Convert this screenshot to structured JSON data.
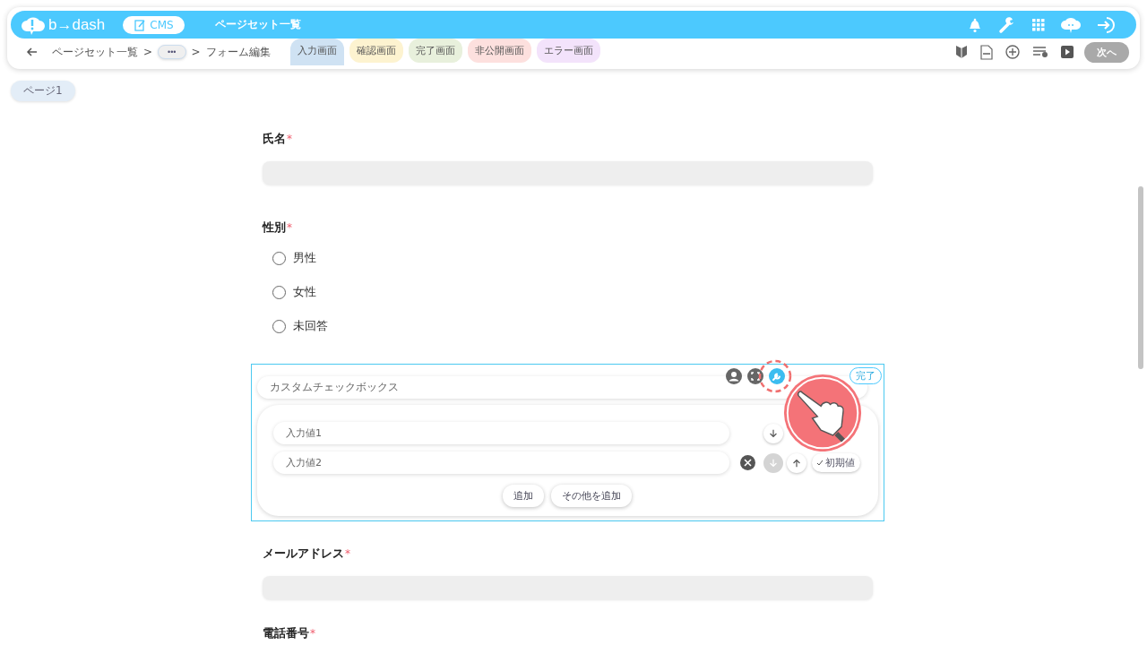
{
  "header": {
    "logo": "b→dash",
    "app_badge": "CMS",
    "title": "ページセット一覧"
  },
  "breadcrumb": {
    "items": [
      {
        "kind": "link",
        "label": "ページセット一覧"
      },
      {
        "kind": "sep",
        "label": ">"
      },
      {
        "kind": "more",
        "label": "•••"
      },
      {
        "kind": "sep",
        "label": ">"
      },
      {
        "kind": "text",
        "label": "フォーム編集"
      }
    ]
  },
  "tabs": [
    {
      "label": "入力画面",
      "selected": true,
      "color": "#cfe2f3"
    },
    {
      "label": "確認画面",
      "selected": false,
      "color": "#fdf3d0"
    },
    {
      "label": "完了画面",
      "selected": false,
      "color": "#e8f0dc"
    },
    {
      "label": "非公開画面",
      "selected": false,
      "color": "#fde0de"
    },
    {
      "label": "エラー画面",
      "selected": false,
      "color": "#f3e3fb"
    }
  ],
  "next_button": {
    "label": "次へ",
    "disabled": true
  },
  "page_chip": "ページ1",
  "fields": [
    {
      "kind": "text",
      "label": "氏名",
      "required_mark": "*"
    },
    {
      "kind": "radio",
      "label": "性別",
      "required_mark": "*",
      "options": [
        {
          "label": "男性",
          "selected": false
        },
        {
          "label": "女性",
          "selected": false
        },
        {
          "label": "未回答",
          "selected": false
        }
      ]
    },
    {
      "kind": "editor",
      "title_value": "カスタムチェックボックス",
      "done_label": "完了",
      "options": [
        {
          "value": "入力値1",
          "buttons": [
            {
              "kind": "down",
              "disabled": false
            }
          ]
        },
        {
          "value": "入力値2",
          "buttons": [
            {
              "kind": "delete"
            },
            {
              "kind": "down",
              "disabled": true
            },
            {
              "kind": "up",
              "disabled": false
            },
            {
              "kind": "default",
              "label": "初期値"
            }
          ]
        }
      ],
      "actions": [
        "追加",
        "その他を追加"
      ]
    },
    {
      "kind": "text",
      "label": "メールアドレス",
      "required_mark": "*"
    },
    {
      "kind": "label",
      "label": "電話番号",
      "required_mark": "*"
    }
  ]
}
